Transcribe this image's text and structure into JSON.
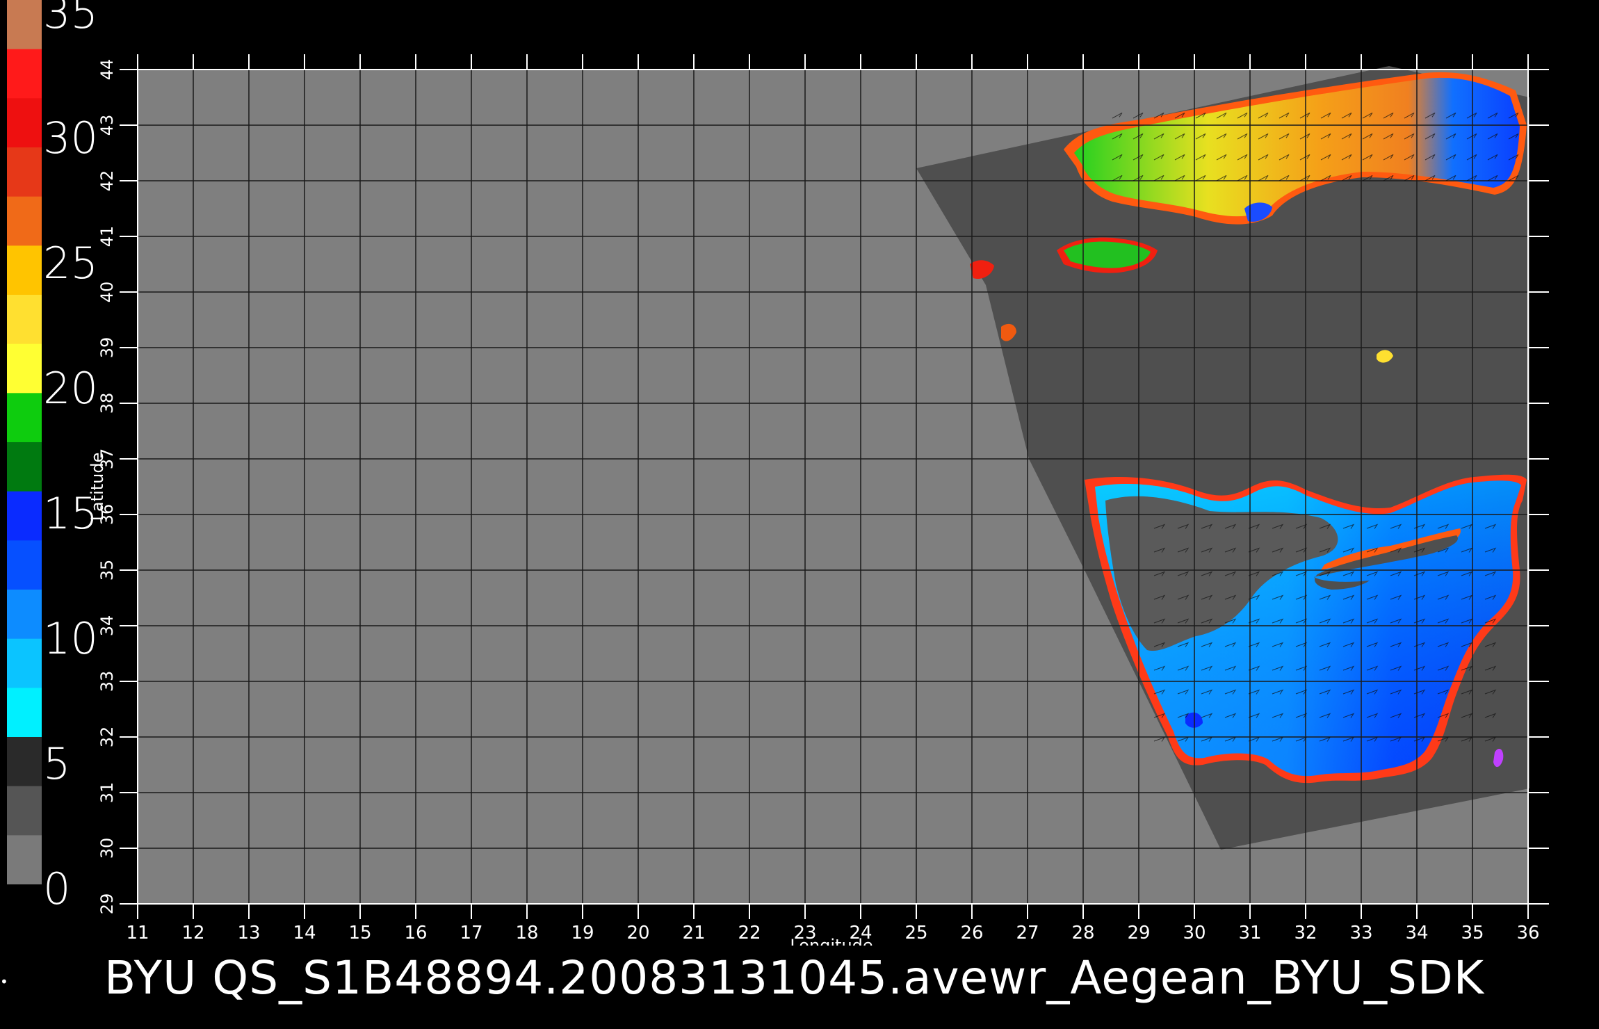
{
  "colorbar": {
    "ticks": [
      "35",
      "30",
      "25",
      "20",
      "15",
      "10",
      "5",
      "0"
    ],
    "segments": [
      {
        "label": "33-35",
        "color": "#c87a52"
      },
      {
        "label": "31-33",
        "color": "#ff1a1a"
      },
      {
        "label": "29-31",
        "color": "#ee1010"
      },
      {
        "label": "27-29",
        "color": "#e63818"
      },
      {
        "label": "25-27",
        "color": "#f06a18"
      },
      {
        "label": "23-25",
        "color": "#ffc400"
      },
      {
        "label": "21-23",
        "color": "#ffe030"
      },
      {
        "label": "19-21",
        "color": "#ffff33"
      },
      {
        "label": "17-19",
        "color": "#0ecc0e"
      },
      {
        "label": "15-17",
        "color": "#007a10"
      },
      {
        "label": "13-15",
        "color": "#0a2bff"
      },
      {
        "label": "11-13",
        "color": "#0650ff"
      },
      {
        "label": "9-11",
        "color": "#0d8cff"
      },
      {
        "label": "7-9",
        "color": "#0bc4ff"
      },
      {
        "label": "5-7",
        "color": "#00f0ff"
      },
      {
        "label": "3-5",
        "color": "#2a2a2a"
      },
      {
        "label": "1-3",
        "color": "#555555"
      },
      {
        "label": "0-1",
        "color": "#7a7a7a"
      }
    ]
  },
  "map": {
    "xlabel": "Longitude",
    "ylabel": "Latitude",
    "lon_ticks": [
      "11",
      "12",
      "13",
      "14",
      "15",
      "16",
      "17",
      "18",
      "19",
      "20",
      "21",
      "22",
      "23",
      "24",
      "25",
      "26",
      "27",
      "28",
      "29",
      "30",
      "31",
      "32",
      "33",
      "34",
      "35",
      "36"
    ],
    "lat_ticks": [
      "29",
      "30",
      "31",
      "32",
      "33",
      "34",
      "35",
      "36",
      "37",
      "38",
      "39",
      "40",
      "41",
      "42",
      "43",
      "44"
    ],
    "colors": {
      "background": "#7f7f7f",
      "swath": "#4f4f4f",
      "grid": "#1a1a1a",
      "frame": "#ffffff"
    }
  },
  "caption": "BYU  QS_S1B48894.20083131045.avewr_Aegean_BYU_SDK"
}
